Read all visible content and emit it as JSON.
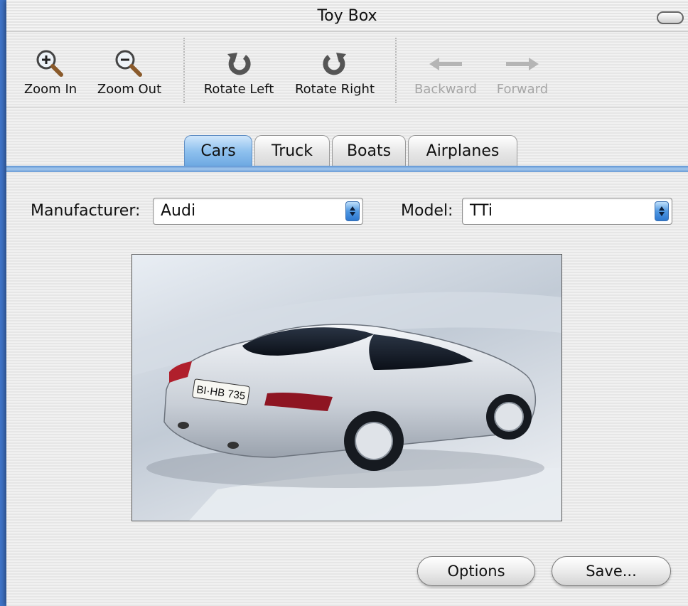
{
  "window": {
    "title": "Toy Box"
  },
  "toolbar": {
    "items": [
      {
        "label": "Zoom In",
        "icon": "zoom-in-icon",
        "enabled": true
      },
      {
        "label": "Zoom Out",
        "icon": "zoom-out-icon",
        "enabled": true
      },
      {
        "label": "Rotate Left",
        "icon": "rotate-left-icon",
        "enabled": true
      },
      {
        "label": "Rotate Right",
        "icon": "rotate-right-icon",
        "enabled": true
      },
      {
        "label": "Backward",
        "icon": "arrow-left-icon",
        "enabled": false
      },
      {
        "label": "Forward",
        "icon": "arrow-right-icon",
        "enabled": false
      }
    ]
  },
  "tabs": [
    {
      "label": "Cars",
      "selected": true
    },
    {
      "label": "Truck",
      "selected": false
    },
    {
      "label": "Boats",
      "selected": false
    },
    {
      "label": "Airplanes",
      "selected": false
    }
  ],
  "form": {
    "manufacturer_label": "Manufacturer:",
    "manufacturer_value": "Audi",
    "model_label": "Model:",
    "model_value": "TTi"
  },
  "image": {
    "plate_text": "BI·HB 735"
  },
  "buttons": {
    "options": "Options",
    "save": "Save..."
  },
  "colors": {
    "desktop": "#3f74c8",
    "tab_active": "#8fc1ee",
    "tab_line": "#5b92d2"
  }
}
